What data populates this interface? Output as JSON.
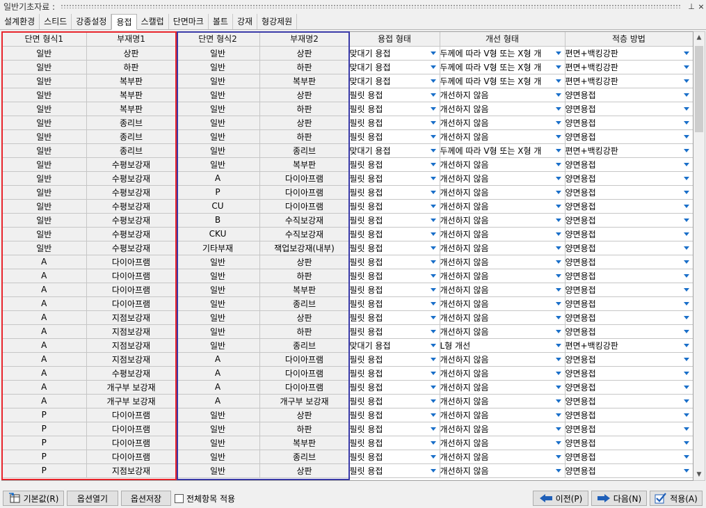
{
  "window": {
    "title": "일반기초자료 :",
    "pin_glyph": "⊥",
    "close_glyph": "×"
  },
  "tabs": [
    {
      "label": "설계환경"
    },
    {
      "label": "스티드"
    },
    {
      "label": "강종설정"
    },
    {
      "label": "용접",
      "active": true
    },
    {
      "label": "스캘럽"
    },
    {
      "label": "단면마크"
    },
    {
      "label": "볼트"
    },
    {
      "label": "강재"
    },
    {
      "label": "형강제원"
    }
  ],
  "grid": {
    "columns": [
      "단면 형식1",
      "부재명1",
      "단면 형식2",
      "부재명2",
      "용접 형태",
      "개선 형태",
      "적층 방법"
    ],
    "rows": [
      [
        "일반",
        "상판",
        "일반",
        "상판",
        "맞대기 용접",
        "두께에 따라 V형 또는 X형 개",
        "편면+백킹강판"
      ],
      [
        "일반",
        "하판",
        "일반",
        "하판",
        "맞대기 용접",
        "두께에 따라 V형 또는 X형 개",
        "편면+백킹강판"
      ],
      [
        "일반",
        "복부판",
        "일반",
        "복부판",
        "맞대기 용접",
        "두께에 따라 V형 또는 X형 개",
        "편면+백킹강판"
      ],
      [
        "일반",
        "복부판",
        "일반",
        "상판",
        "필릿 용접",
        "개선하지 않음",
        "양면용접"
      ],
      [
        "일반",
        "복부판",
        "일반",
        "하판",
        "필릿 용접",
        "개선하지 않음",
        "양면용접"
      ],
      [
        "일반",
        "종리브",
        "일반",
        "상판",
        "필릿 용접",
        "개선하지 않음",
        "양면용접"
      ],
      [
        "일반",
        "종리브",
        "일반",
        "하판",
        "필릿 용접",
        "개선하지 않음",
        "양면용접"
      ],
      [
        "일반",
        "종리브",
        "일반",
        "종리브",
        "맞대기 용접",
        "두께에 따라 V형 또는 X형 개",
        "편면+백킹강판"
      ],
      [
        "일반",
        "수평보강재",
        "일반",
        "복부판",
        "필릿 용접",
        "개선하지 않음",
        "양면용접"
      ],
      [
        "일반",
        "수평보강재",
        "A",
        "다이아프램",
        "필릿 용접",
        "개선하지 않음",
        "양면용접"
      ],
      [
        "일반",
        "수평보강재",
        "P",
        "다이아프램",
        "필릿 용접",
        "개선하지 않음",
        "양면용접"
      ],
      [
        "일반",
        "수평보강재",
        "CU",
        "다이아프램",
        "필릿 용접",
        "개선하지 않음",
        "양면용접"
      ],
      [
        "일반",
        "수평보강재",
        "B",
        "수직보강재",
        "필릿 용접",
        "개선하지 않음",
        "양면용접"
      ],
      [
        "일반",
        "수평보강재",
        "CKU",
        "수직보강재",
        "필릿 용접",
        "개선하지 않음",
        "양면용접"
      ],
      [
        "일반",
        "수평보강재",
        "기타부재",
        "잭업보강재(내부)",
        "필릿 용접",
        "개선하지 않음",
        "양면용접"
      ],
      [
        "A",
        "다이아프램",
        "일반",
        "상판",
        "필릿 용접",
        "개선하지 않음",
        "양면용접"
      ],
      [
        "A",
        "다이아프램",
        "일반",
        "하판",
        "필릿 용접",
        "개선하지 않음",
        "양면용접"
      ],
      [
        "A",
        "다이아프램",
        "일반",
        "복부판",
        "필릿 용접",
        "개선하지 않음",
        "양면용접"
      ],
      [
        "A",
        "다이아프램",
        "일반",
        "종리브",
        "필릿 용접",
        "개선하지 않음",
        "양면용접"
      ],
      [
        "A",
        "지점보강재",
        "일반",
        "상판",
        "필릿 용접",
        "개선하지 않음",
        "양면용접"
      ],
      [
        "A",
        "지점보강재",
        "일반",
        "하판",
        "필릿 용접",
        "개선하지 않음",
        "양면용접"
      ],
      [
        "A",
        "지점보강재",
        "일반",
        "종리브",
        "맞대기 용접",
        "L형 개선",
        "편면+백킹강판"
      ],
      [
        "A",
        "지점보강재",
        "A",
        "다이아프램",
        "필릿 용접",
        "개선하지 않음",
        "양면용접"
      ],
      [
        "A",
        "수평보강재",
        "A",
        "다이아프램",
        "필릿 용접",
        "개선하지 않음",
        "양면용접"
      ],
      [
        "A",
        "개구부 보강재",
        "A",
        "다이아프램",
        "필릿 용접",
        "개선하지 않음",
        "양면용접"
      ],
      [
        "A",
        "개구부 보강재",
        "A",
        "개구부 보강재",
        "필릿 용접",
        "개선하지 않음",
        "양면용접"
      ],
      [
        "P",
        "다이아프램",
        "일반",
        "상판",
        "필릿 용접",
        "개선하지 않음",
        "양면용접"
      ],
      [
        "P",
        "다이아프램",
        "일반",
        "하판",
        "필릿 용접",
        "개선하지 않음",
        "양면용접"
      ],
      [
        "P",
        "다이아프램",
        "일반",
        "복부판",
        "필릿 용접",
        "개선하지 않음",
        "양면용접"
      ],
      [
        "P",
        "다이아프램",
        "일반",
        "종리브",
        "필릿 용접",
        "개선하지 않음",
        "양면용접"
      ],
      [
        "P",
        "지점보강재",
        "일반",
        "상판",
        "필릿 용접",
        "개선하지 않음",
        "양면용접"
      ]
    ]
  },
  "colors": {
    "highlight_left": "#e8242b",
    "highlight_right": "#3a3aa8",
    "dropdown_arrow": "#1a6fc9"
  },
  "buttons": {
    "defaults": "기본값(R)",
    "open_options": "옵션열기",
    "save_options": "옵션저장",
    "apply_all": "전체항목 적용",
    "prev": "이전(P)",
    "next": "다음(N)",
    "apply": "적용(A)"
  },
  "icons": {
    "defaults": "reset-table-icon",
    "prev": "arrow-left-icon",
    "next": "arrow-right-icon",
    "apply": "checkmark-icon"
  }
}
